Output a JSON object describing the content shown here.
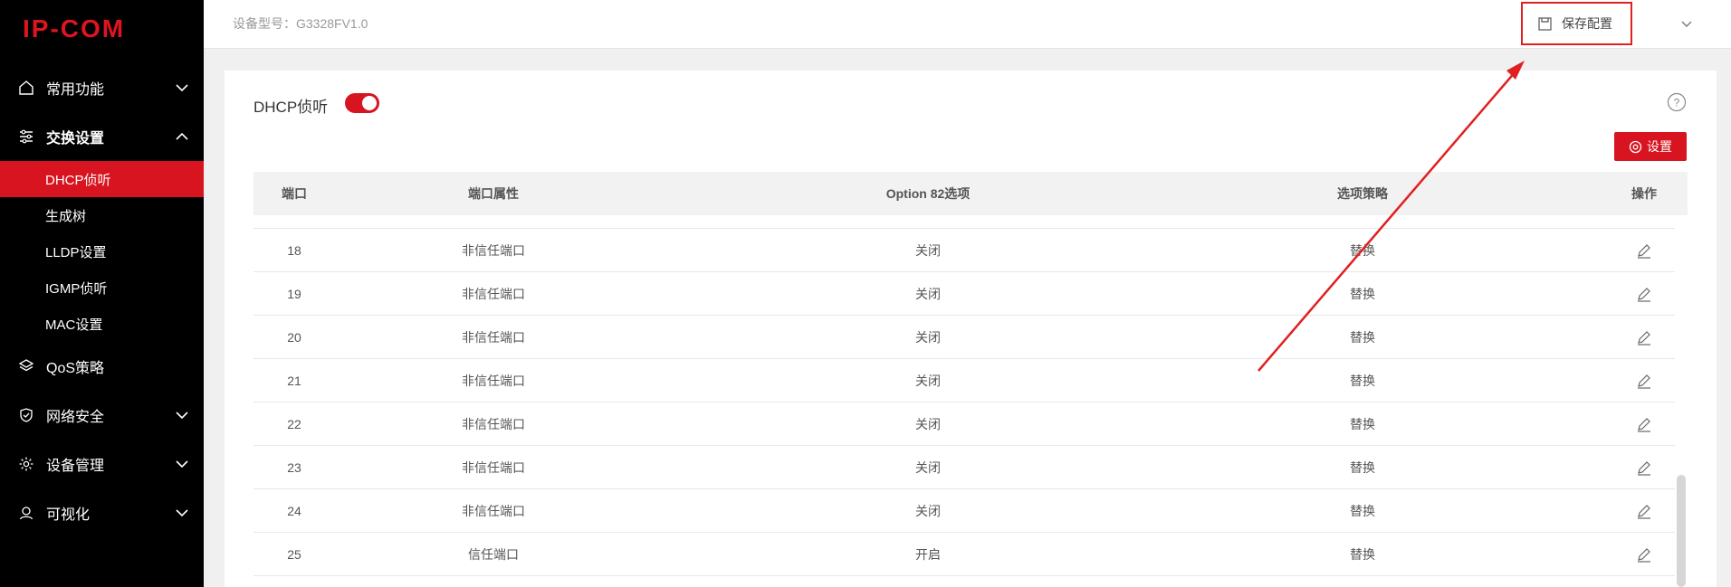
{
  "brand": {
    "logo_text": "IP-COM"
  },
  "topbar": {
    "model_label": "设备型号：G3328FV1.0",
    "save_config_label": "保存配置"
  },
  "sidebar": {
    "groups": [
      {
        "label": "常用功能",
        "icon": "home-icon",
        "expanded": false
      },
      {
        "label": "交换设置",
        "icon": "sliders-icon",
        "expanded": true
      },
      {
        "label": "QoS策略",
        "icon": "layers-icon",
        "expanded": false
      },
      {
        "label": "网络安全",
        "icon": "shield-icon",
        "expanded": false
      },
      {
        "label": "设备管理",
        "icon": "gear-icon",
        "expanded": false
      },
      {
        "label": "可视化",
        "icon": "user-icon",
        "expanded": false
      }
    ],
    "sub_items": [
      {
        "label": "DHCP侦听",
        "selected": true
      },
      {
        "label": "生成树",
        "selected": false
      },
      {
        "label": "LLDP设置",
        "selected": false
      },
      {
        "label": "IGMP侦听",
        "selected": false
      },
      {
        "label": "MAC设置",
        "selected": false
      }
    ]
  },
  "main": {
    "title": "DHCP侦听",
    "toggle_on": true,
    "settings_label": "设置",
    "table": {
      "headers": [
        "端口",
        "端口属性",
        "Option 82选项",
        "选项策略",
        "操作"
      ],
      "rows": [
        {
          "port": "18",
          "attribute": "非信任端口",
          "option82": "关闭",
          "policy": "替换"
        },
        {
          "port": "19",
          "attribute": "非信任端口",
          "option82": "关闭",
          "policy": "替换"
        },
        {
          "port": "20",
          "attribute": "非信任端口",
          "option82": "关闭",
          "policy": "替换"
        },
        {
          "port": "21",
          "attribute": "非信任端口",
          "option82": "关闭",
          "policy": "替换"
        },
        {
          "port": "22",
          "attribute": "非信任端口",
          "option82": "关闭",
          "policy": "替换"
        },
        {
          "port": "23",
          "attribute": "非信任端口",
          "option82": "关闭",
          "policy": "替换"
        },
        {
          "port": "24",
          "attribute": "非信任端口",
          "option82": "关闭",
          "policy": "替换"
        },
        {
          "port": "25",
          "attribute": "信任端口",
          "option82": "开启",
          "policy": "替换"
        }
      ]
    }
  },
  "colors": {
    "accent": "#d7141f",
    "sidebar_bg": "#000000",
    "annotation": "#e02020"
  }
}
